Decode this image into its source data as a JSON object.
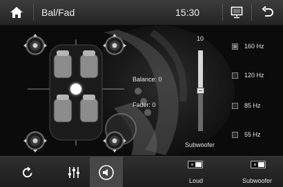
{
  "header": {
    "title": "Bal/Fad",
    "time": "15:30"
  },
  "readouts": {
    "balance": "Balance: 0",
    "fader": "Fader: 0"
  },
  "subwoofer": {
    "max_label": "10",
    "label": "Subwoofer",
    "level_fraction": 0.5
  },
  "frequencies": [
    {
      "label": "160 Hz",
      "selected": true
    },
    {
      "label": "120 Hz",
      "selected": false
    },
    {
      "label": "85 Hz",
      "selected": false
    },
    {
      "label": "55 Hz",
      "selected": false
    }
  ],
  "bottom": {
    "loud_label": "Loud",
    "subwoofer_label": "Subwoofer"
  },
  "colors": {
    "header_bg": "#2e2e2e",
    "active_button": "#474747",
    "text": "#e6e6e6"
  }
}
